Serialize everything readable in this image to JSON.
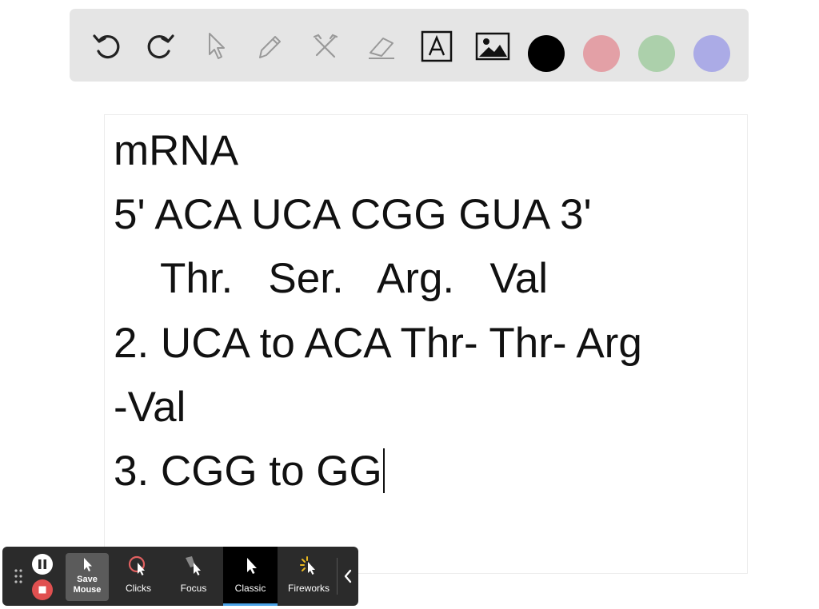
{
  "toolbar": {
    "tools": [
      "undo-icon",
      "redo-icon",
      "pointer-icon",
      "pen-icon",
      "tools-icon",
      "eraser-icon",
      "text-box-icon",
      "image-icon"
    ],
    "colors": [
      "#000000",
      "#e3a0a6",
      "#acd0ab",
      "#ababe6"
    ]
  },
  "canvas": {
    "lines": [
      "mRNA",
      "5' ACA UCA CGG GUA 3'",
      "    Thr.   Ser.   Arg.   Val",
      "2. UCA to ACA Thr- Thr- Arg",
      "-Val",
      "3. CGG to GG"
    ]
  },
  "recorder": {
    "save_label_1": "Save",
    "save_label_2": "Mouse",
    "clicks_label": "Clicks",
    "focus_label": "Focus",
    "classic_label": "Classic",
    "fireworks_label": "Fireworks",
    "pause_color": "#ffffff",
    "stop_color": "#e05050",
    "active_underline_color": "#4aa3e8"
  }
}
